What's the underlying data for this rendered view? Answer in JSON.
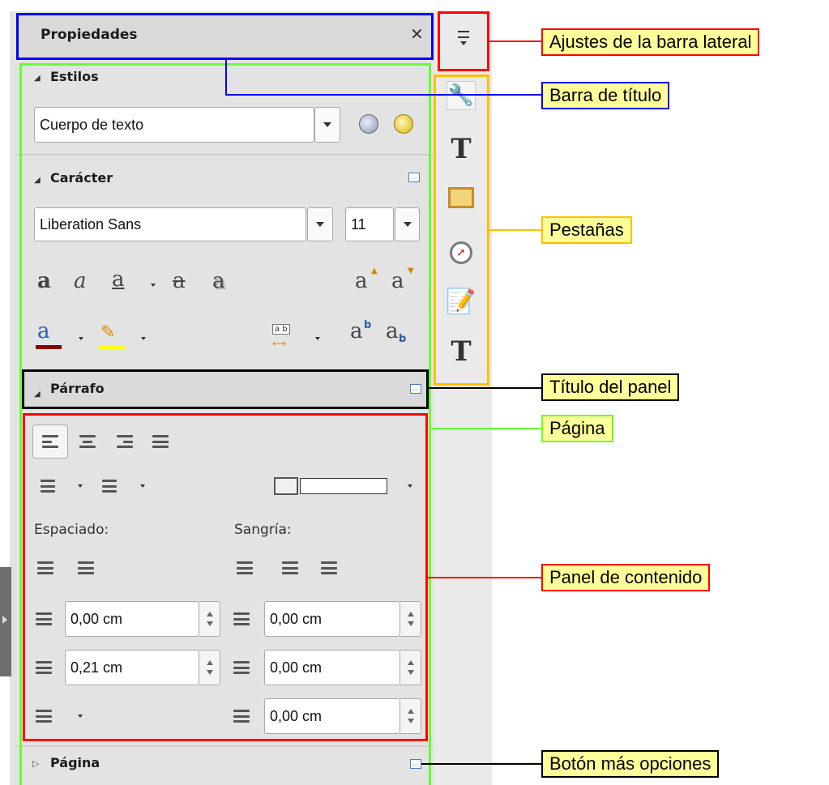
{
  "panel": {
    "title": "Propiedades",
    "close_glyph": "✕"
  },
  "sections": {
    "styles": {
      "label": "Estilos",
      "expanded": true
    },
    "character": {
      "label": "Carácter",
      "expanded": true
    },
    "paragraph": {
      "label": "Párrafo",
      "expanded": true
    },
    "page": {
      "label": "Página",
      "expanded": false
    }
  },
  "styles": {
    "paragraph_style": "Cuerpo de texto"
  },
  "character": {
    "font_name": "Liberation Sans",
    "font_size": "11",
    "glyphs": {
      "bold": "a",
      "italic": "a",
      "underline": "a",
      "strikethrough": "a",
      "shadow": "a",
      "grow": "a",
      "shrink": "a",
      "superscript": "a",
      "subscript": "a",
      "spacing": "a b"
    },
    "font_color": "#8b0000",
    "highlight_color": "#ffff00"
  },
  "paragraph": {
    "spacing_label": "Espaciado:",
    "indent_label": "Sangría:",
    "above_spacing": "0,00 cm",
    "below_spacing": "0,21 cm",
    "before_indent": "0,00 cm",
    "after_indent": "0,00 cm",
    "first_line_indent": "0,00 cm"
  },
  "annotations": {
    "sidebar_settings": "Ajustes de la barra lateral",
    "title_bar": "Barra de título",
    "tabs": "Pestañas",
    "panel_title": "Título del panel",
    "page": "Página",
    "content_panel": "Panel de contenido",
    "more_options": "Botón más opciones"
  },
  "colors": {
    "red": "#ff0000",
    "blue": "#0000ff",
    "green": "#66ff33",
    "orange": "#ffc000",
    "black": "#000000",
    "note_bg": "#ffff99"
  }
}
